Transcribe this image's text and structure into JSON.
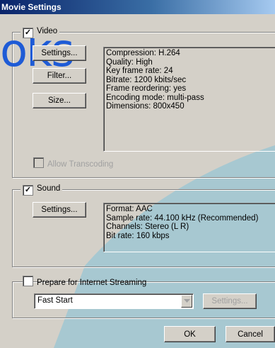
{
  "window": {
    "title": "Movie Settings"
  },
  "watermark": "oks",
  "video": {
    "label": "Video",
    "checked": true,
    "settings_button": "Settings...",
    "filter_button": "Filter...",
    "size_button": "Size...",
    "info": [
      "Compression: H.264",
      "Quality: High",
      "Key frame rate: 24",
      "Bitrate: 1200 kbits/sec",
      "Frame reordering: yes",
      "Encoding mode: multi-pass",
      "Dimensions: 800x450"
    ],
    "allow_transcoding": "Allow Transcoding"
  },
  "sound": {
    "label": "Sound",
    "checked": true,
    "settings_button": "Settings...",
    "info": [
      "Format: AAC",
      "Sample rate: 44.100 kHz (Recommended)",
      "Channels: Stereo (L R)",
      "Bit rate: 160 kbps"
    ]
  },
  "streaming": {
    "label": "Prepare for Internet Streaming",
    "checked": false,
    "dropdown_value": "Fast Start",
    "settings_button": "Settings..."
  },
  "footer": {
    "ok_label": "OK",
    "cancel_label": "Cancel"
  },
  "colors": {
    "dialog": "#d4d0c8",
    "overlay": "#a7c8d1",
    "title_bar": "#0a246a",
    "watermark": "#1e5bd6"
  }
}
